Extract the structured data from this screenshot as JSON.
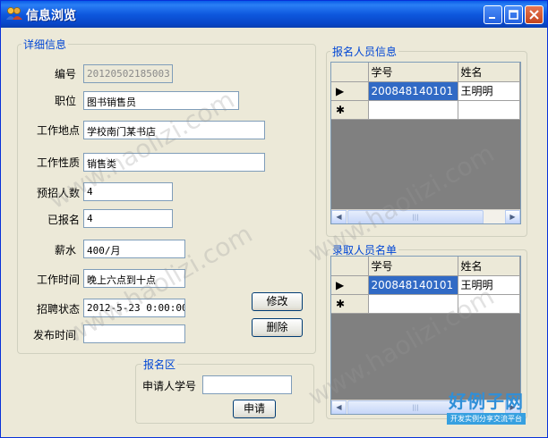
{
  "window": {
    "title": "信息浏览",
    "buttons": {
      "minimize": "_",
      "maximize": "□",
      "close": "✕"
    }
  },
  "details": {
    "group_title": "详细信息",
    "fields": {
      "id": {
        "label": "编号",
        "value": "20120502185003"
      },
      "position": {
        "label": "职位",
        "value": "图书销售员"
      },
      "location": {
        "label": "工作地点",
        "value": "学校南门某书店"
      },
      "nature": {
        "label": "工作性质",
        "value": "销售类"
      },
      "planned": {
        "label": "预招人数",
        "value": "4"
      },
      "enrolled": {
        "label": "已报名",
        "value": "4"
      },
      "salary": {
        "label": "薪水",
        "value": "400/月"
      },
      "hours": {
        "label": "工作时间",
        "value": "晚上六点到十点"
      },
      "status": {
        "label": "招聘状态",
        "value": "2012-5-23 0:00:00"
      },
      "publish": {
        "label": "发布时间",
        "value": ""
      }
    },
    "modify_button": "修改",
    "delete_button": "删除"
  },
  "apply": {
    "group_title": "报名区",
    "student_label": "申请人学号",
    "student_value": "",
    "apply_button": "申请"
  },
  "applicants": {
    "group_title": "报名人员信息",
    "columns": [
      "学号",
      "姓名"
    ],
    "rows": [
      {
        "indicator": "▶",
        "student_id": "200848140101",
        "name": "王明明"
      }
    ],
    "new_row_indicator": "✱"
  },
  "hired": {
    "group_title": "录取人员名单",
    "columns": [
      "学号",
      "姓名"
    ],
    "rows": [
      {
        "indicator": "▶",
        "student_id": "200848140101",
        "name": "王明明"
      }
    ],
    "new_row_indicator": "✱"
  },
  "watermark": {
    "text": "www.haolizi.com"
  },
  "brand": {
    "name": "好例子网",
    "slogan": "开发实例分享交流平台"
  },
  "colors": {
    "title_bar": "#0a5de8",
    "group_title": "#0046d5",
    "selection": "#316ac5",
    "grid_empty": "#808080"
  }
}
